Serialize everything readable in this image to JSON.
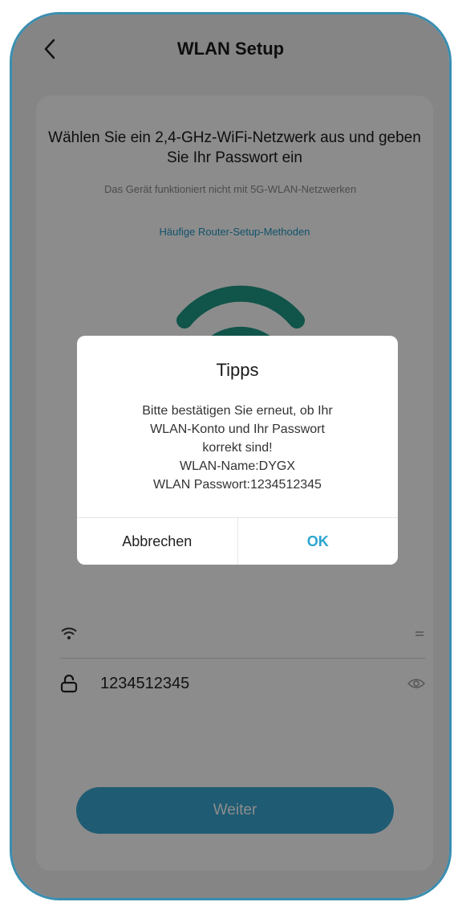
{
  "header": {
    "title": "WLAN Setup"
  },
  "intro": {
    "heading": "Wählen Sie ein 2,4-GHz-WiFi-Netzwerk aus und geben Sie Ihr Passwort ein",
    "note": "Das Gerät funktioniert nicht mit 5G-WLAN-Netzwerken",
    "link": "Häufige Router-Setup-Methoden"
  },
  "form": {
    "ssid_value": "",
    "password_value": "1234512345"
  },
  "next_button": "Weiter",
  "dialog": {
    "title": "Tipps",
    "lines": [
      "Bitte bestätigen Sie erneut, ob Ihr",
      "WLAN-Konto und Ihr Passwort",
      "korrekt sind!",
      "WLAN-Name:DYGX",
      "WLAN Passwort:1234512345"
    ],
    "cancel_label": "Abbrechen",
    "ok_label": "OK"
  },
  "colors": {
    "accent": "#39a8d2",
    "wifi_icon": "#1f9a86",
    "frame": "#3a8eb0"
  },
  "icons": [
    "back-chevron-icon",
    "wifi-large-icon",
    "wifi-icon",
    "lock-icon",
    "eye-icon"
  ]
}
